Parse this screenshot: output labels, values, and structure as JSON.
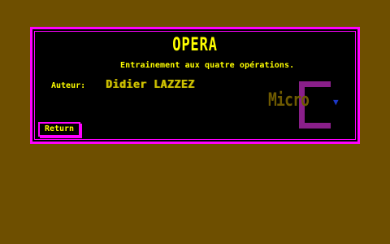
{
  "dialog": {
    "title": "OPERA",
    "subtitle": "Entrainement aux quatre opérations.",
    "author_label": "Auteur:",
    "author_name": "Didier LAZZEZ",
    "return_label": "Return"
  },
  "logo": {
    "text": "Micro",
    "letter": "C",
    "icon": "down-arrow-icon"
  },
  "colors": {
    "background": "#6e4f00",
    "panel": "#000000",
    "border": "#ff00ff",
    "text": "#ffff00",
    "logo_c": "#8a1f8a",
    "logo_micro": "#6e5a00",
    "logo_arrow": "#1c38c8"
  }
}
